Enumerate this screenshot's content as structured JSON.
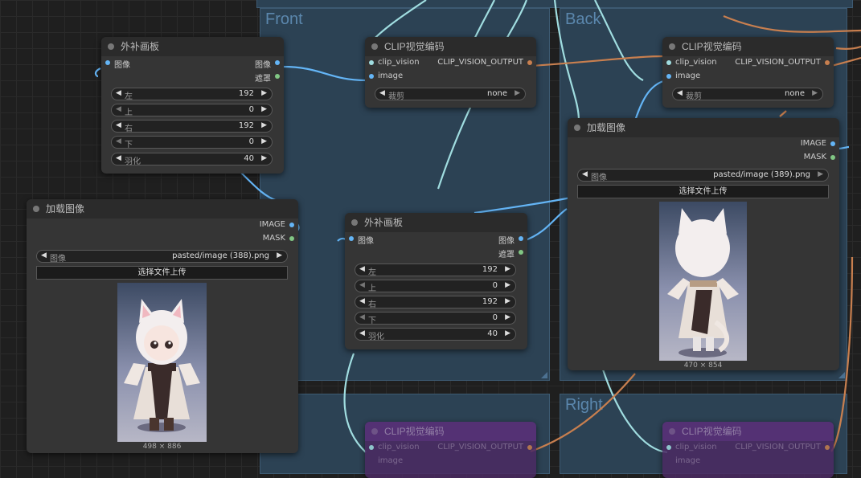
{
  "groups": {
    "front": "Front",
    "back": "Back",
    "right": "Right"
  },
  "colors": {
    "image_link": "#64b5f6",
    "clip_link": "#c87f4f",
    "pale_link": "#a0dde0",
    "mask_dot": "#81c784"
  },
  "outpaint_top": {
    "title": "外补画板",
    "in_image": "图像",
    "out_image": "图像",
    "out_mask": "遮罩",
    "params": [
      {
        "label": "左",
        "value": "192"
      },
      {
        "label": "上",
        "value": "0"
      },
      {
        "label": "右",
        "value": "192"
      },
      {
        "label": "下",
        "value": "0"
      },
      {
        "label": "羽化",
        "value": "40"
      }
    ]
  },
  "outpaint_mid": {
    "title": "外补画板",
    "in_image": "图像",
    "out_image": "图像",
    "out_mask": "遮罩",
    "params": [
      {
        "label": "左",
        "value": "192"
      },
      {
        "label": "上",
        "value": "0"
      },
      {
        "label": "右",
        "value": "192"
      },
      {
        "label": "下",
        "value": "0"
      },
      {
        "label": "羽化",
        "value": "40"
      }
    ]
  },
  "clip_front": {
    "title": "CLIP视觉编码",
    "in_clip": "clip_vision",
    "in_image": "image",
    "out": "CLIP_VISION_OUTPUT",
    "crop_label": "裁剪",
    "crop_value": "none"
  },
  "clip_back": {
    "title": "CLIP视觉编码",
    "in_clip": "clip_vision",
    "in_image": "image",
    "out": "CLIP_VISION_OUTPUT",
    "crop_label": "裁剪",
    "crop_value": "none"
  },
  "clip_bottom_left": {
    "title": "CLIP视觉编码",
    "in_clip": "clip_vision",
    "in_image": "image",
    "out": "CLIP_VISION_OUTPUT"
  },
  "clip_bottom_right": {
    "title": "CLIP视觉编码",
    "in_clip": "clip_vision",
    "in_image": "image",
    "out": "CLIP_VISION_OUTPUT"
  },
  "load_left": {
    "title": "加载图像",
    "out_image": "IMAGE",
    "out_mask": "MASK",
    "image_label": "图像",
    "image_value": "pasted/image (388).png",
    "upload": "选择文件上传",
    "dims": "498 × 886"
  },
  "load_right": {
    "title": "加载图像",
    "out_image": "IMAGE",
    "out_mask": "MASK",
    "image_label": "图像",
    "image_value": "pasted/image (389).png",
    "upload": "选择文件上传",
    "dims": "470 × 854"
  }
}
